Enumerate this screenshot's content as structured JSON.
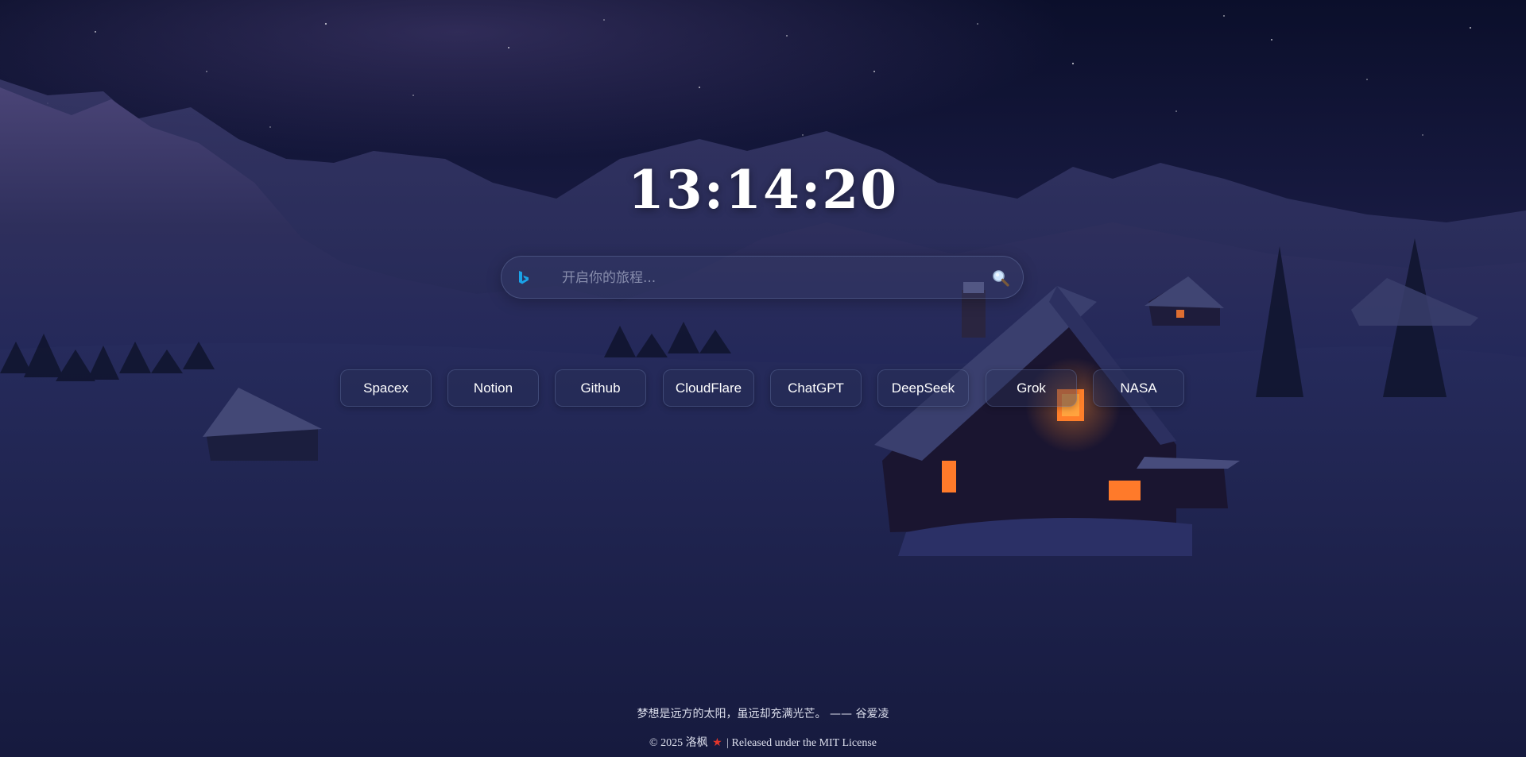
{
  "clock": {
    "time": "13:14:20"
  },
  "search": {
    "engine_icon": "bing-logo-icon",
    "placeholder": "开启你的旅程...",
    "value": "",
    "submit_icon": "magnifier-icon"
  },
  "links": [
    {
      "label": "Spacex"
    },
    {
      "label": "Notion"
    },
    {
      "label": "Github"
    },
    {
      "label": "CloudFlare"
    },
    {
      "label": "ChatGPT"
    },
    {
      "label": "DeepSeek"
    },
    {
      "label": "Grok"
    },
    {
      "label": "NASA"
    }
  ],
  "footer": {
    "quote": "梦想是远方的太阳，虽远却充满光芒。 —— 谷爱凌",
    "copyright_prefix": "© 2025 洛枫",
    "star_icon": "star-icon",
    "separator": "|",
    "license_text": "Released under the MIT License"
  },
  "colors": {
    "sky_top": "#0b0f2b",
    "snow_shadow": "#1a1f47",
    "window_glow": "#ff7a2a",
    "star_red": "#e2352b",
    "bing_blue": "#1aa3e8"
  }
}
